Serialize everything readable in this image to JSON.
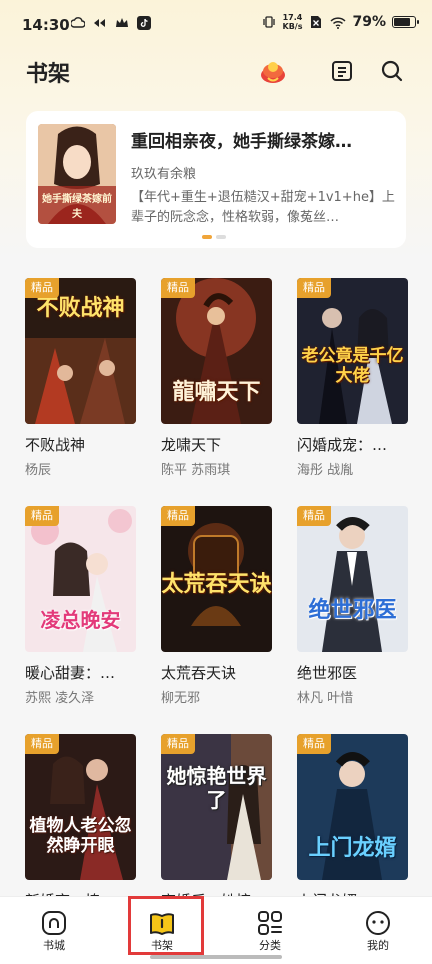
{
  "status_bar": {
    "time": "14:30",
    "net_speed_value": "17.4",
    "net_speed_unit": "KB/s",
    "battery_text": "79%",
    "battery_level": 0.79
  },
  "header": {
    "title": "书架"
  },
  "banner": {
    "title": "重回相亲夜，她手撕绿茶嫁…",
    "author": "玖玖有余粮",
    "description": "【年代+重生+退伍糙汉+甜宠+1v1+he】上辈子的阮念念，性格软弱，像菟丝…",
    "cover_text": "她手撕绿茶嫁前夫",
    "page_count": 2,
    "active_page": 1
  },
  "books": [
    {
      "name": "不败战神",
      "authors": "杨辰",
      "tag": "精品",
      "cover_text": "不败战神"
    },
    {
      "name": "龙啸天下",
      "authors": "陈平  苏雨琪",
      "tag": "精品",
      "cover_text": "龍嘯天下"
    },
    {
      "name": "闪婚成宠：…",
      "authors": "海彤  战胤",
      "tag": "精品",
      "cover_text": "老公竟是千亿大佬"
    },
    {
      "name": "暖心甜妻：…",
      "authors": "苏熙  凌久泽",
      "tag": "精品",
      "cover_text": "凌总晚安"
    },
    {
      "name": "太荒吞天诀",
      "authors": "柳无邪",
      "tag": "精品",
      "cover_text": "太荒吞天诀"
    },
    {
      "name": "绝世邪医",
      "authors": "林凡  叶惜",
      "tag": "精品",
      "cover_text": "绝世邪医"
    },
    {
      "name": "新婚夜，植…",
      "authors": "",
      "tag": "精品",
      "cover_text": "植物人老公忽然睁开眼"
    },
    {
      "name": "离婚后，她惊…",
      "authors": "",
      "tag": "精品",
      "cover_text": "她惊艳世界了"
    },
    {
      "name": "上门龙婿",
      "authors": "",
      "tag": "精品",
      "cover_text": "上门龙婿"
    }
  ],
  "bottom_nav": [
    {
      "label": "书城",
      "icon": "home-icon"
    },
    {
      "label": "书架",
      "icon": "bookshelf-icon",
      "active": true
    },
    {
      "label": "分类",
      "icon": "category-icon"
    },
    {
      "label": "我的",
      "icon": "profile-icon"
    }
  ],
  "colors": {
    "accent": "#f0a53a",
    "tag": "#e7a12c",
    "highlight": "#e23a3a",
    "active_nav": "#f5c518"
  }
}
